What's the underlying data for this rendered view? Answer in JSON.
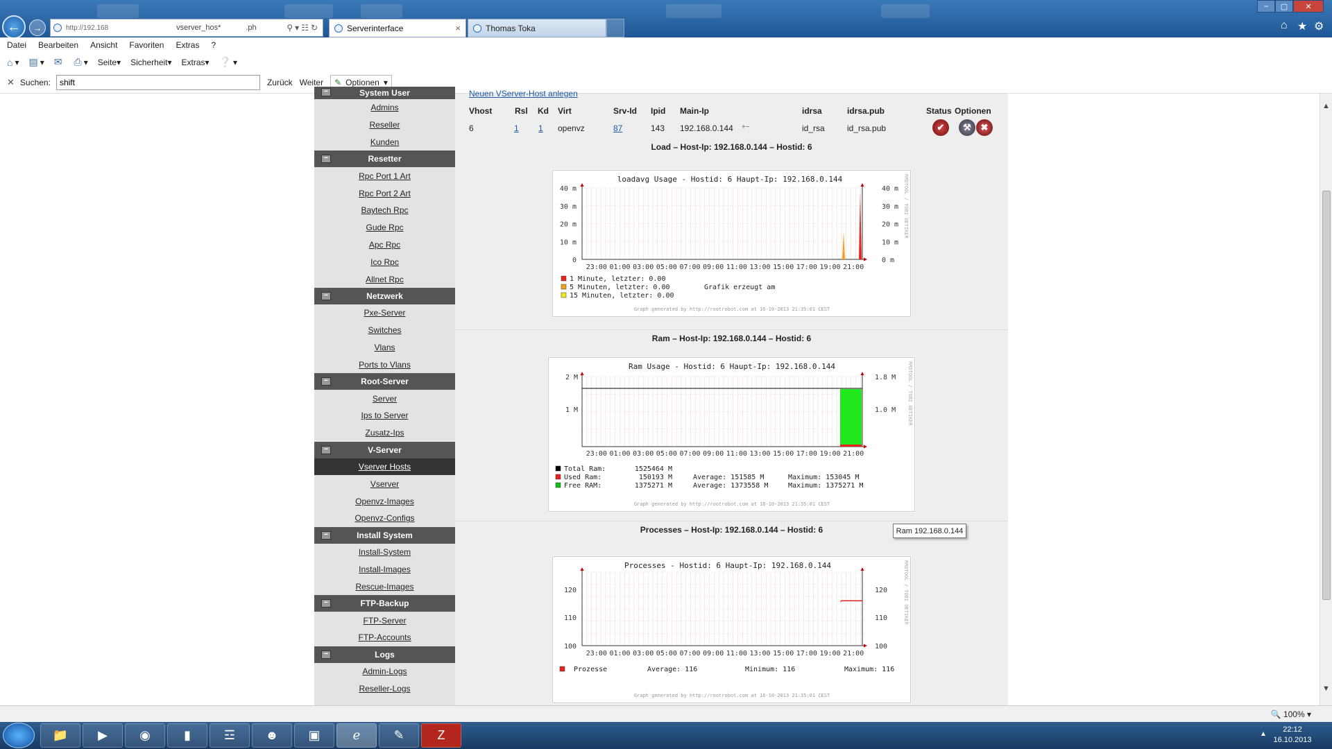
{
  "browser": {
    "url": "http://192.168",
    "url_fragment": "vserver_hos*",
    "url_fragment2": ".ph",
    "tabs": [
      {
        "label": "Serverinterface",
        "active": true
      },
      {
        "label": "Thomas Toka",
        "active": false
      }
    ]
  },
  "menubar": [
    "Datei",
    "Bearbeiten",
    "Ansicht",
    "Favoriten",
    "Extras",
    "?"
  ],
  "cmdbar": {
    "page": "Seite",
    "security": "Sicherheit",
    "extras": "Extras"
  },
  "findbar": {
    "label": "Suchen:",
    "value": "shift",
    "prev": "Zurück",
    "next": "Weiter",
    "options": "Optionen"
  },
  "sidebar": {
    "top_partial": "System User",
    "items_top": [
      "Admins",
      "Reseller",
      "Kunden"
    ],
    "sections": [
      {
        "title": "Resetter",
        "items": [
          "Rpc Port 1 Art",
          "Rpc Port 2 Art",
          "Baytech Rpc",
          "Gude Rpc",
          "Apc Rpc",
          "Ico Rpc",
          "Allnet Rpc"
        ]
      },
      {
        "title": "Netzwerk",
        "items": [
          "Pxe-Server",
          "Switches",
          "Vlans",
          "Ports to Vlans"
        ]
      },
      {
        "title": "Root-Server",
        "items": [
          "Server",
          "Ips to Server",
          "Zusatz-Ips"
        ]
      },
      {
        "title": "V-Server",
        "items": [
          "Vserver Hosts",
          "Vserver",
          "Openvz-Images",
          "Openvz-Configs"
        ]
      },
      {
        "title": "Install System",
        "items": [
          "Install-System",
          "Install-Images",
          "Rescue-Images"
        ]
      },
      {
        "title": "FTP-Backup",
        "items": [
          "FTP-Server",
          "FTP-Accounts"
        ]
      },
      {
        "title": "Logs",
        "items": [
          "Admin-Logs",
          "Reseller-Logs"
        ]
      }
    ],
    "active_item": "Vserver Hosts"
  },
  "main": {
    "new_link": "Neuen VServer-Host anlegen",
    "headers": [
      "Vhost",
      "Rsl",
      "Kd",
      "Virt",
      "Srv-Id",
      "Ipid",
      "Main-Ip",
      "idrsa",
      "idrsa.pub",
      "Status",
      "Optionen"
    ],
    "row": {
      "vhost": "6",
      "rsl": "1",
      "kd": "1",
      "virt": "openvz",
      "srv_id": "87",
      "ipid": "143",
      "main_ip": "192.168.0.144",
      "idrsa": "id_rsa",
      "idrsa_pub": "id_rsa.pub"
    },
    "sections": {
      "load": "Load – Host-Ip: 192.168.0.144 – Hostid: 6",
      "ram": "Ram – Host-Ip: 192.168.0.144 – Hostid: 6",
      "proc": "Processes – Host-Ip: 192.168.0.144 – Hostid: 6"
    }
  },
  "graphs": {
    "time_labels": [
      "23:00",
      "01:00",
      "03:00",
      "05:00",
      "07:00",
      "09:00",
      "11:00",
      "13:00",
      "15:00",
      "17:00",
      "19:00",
      "21:00"
    ],
    "side_label": "RRDTOOL / TOBI OETIKER",
    "footer": "Graph generated by http://rootrobot.com at 16-10-2013 21:35:01 CEST",
    "load": {
      "title": "loadavg Usage - Hostid: 6 Haupt-Ip: 192.168.0.144",
      "y_left": [
        "40 m",
        "30 m",
        "20 m",
        "10 m",
        "0"
      ],
      "y_right": [
        "40 m",
        "30 m",
        "20 m",
        "10 m",
        "0 m"
      ],
      "legend": [
        {
          "label": "1 Minute,  letzter:  0.00",
          "color": "#e8221d"
        },
        {
          "label": "5 Minuten,  letzter:  0.00",
          "color": "#f2a11b"
        },
        {
          "label": "15 Minuten, letzter:  0.00",
          "color": "#f0e81a"
        }
      ],
      "note": "Grafik erzeugt am"
    },
    "ram": {
      "title": "Ram Usage - Hostid: 6 Haupt-Ip: 192.168.0.144",
      "y_left": [
        "2 M",
        "1 M"
      ],
      "y_right": [
        "1.8 M",
        "1.0 M"
      ],
      "legend": [
        {
          "label": "Total Ram:",
          "value": "1525464 M",
          "avg": "",
          "max": "",
          "color": "#000000"
        },
        {
          "label": "Used Ram:",
          "value": "150193 M",
          "avg": "Average:  151585 M",
          "max": "Maximum:  153045 M",
          "color": "#e8221d"
        },
        {
          "label": "Free RAM:",
          "value": "1375271 M",
          "avg": "Average: 1373558 M",
          "max": "Maximum: 1375271 M",
          "color": "#11c01a"
        }
      ]
    },
    "proc": {
      "title": "Processes - Hostid: 6 Haupt-Ip: 192.168.0.144",
      "y_left": [
        "120",
        "110",
        "100"
      ],
      "y_right": [
        "120",
        "110",
        "100"
      ],
      "legend": {
        "label": "Prozesse",
        "avg": "Average:  116",
        "min": "Minimum:  116",
        "max": "Maximum:  116",
        "color": "#e8221d"
      }
    }
  },
  "tooltip": "Ram 192.168.0.144",
  "statusbar": {
    "zoom": "100%"
  },
  "taskbar": {
    "time": "22:12",
    "date": "16.10.2013"
  }
}
